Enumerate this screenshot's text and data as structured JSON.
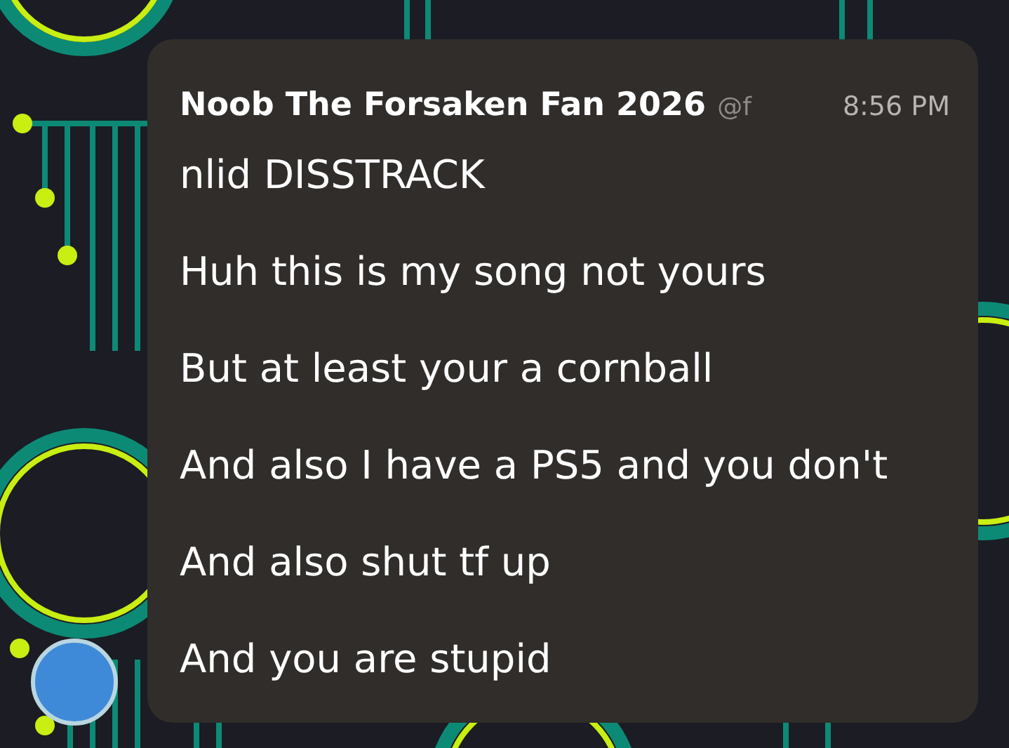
{
  "message": {
    "author": "Noob The Forsaken Fan 2026",
    "handle": "@f",
    "time": "8:56 PM",
    "lines": [
      "nlid DISSTRACK",
      "Huh this is my song not yours",
      "But at least your a cornball",
      "And also I have a PS5 and you don't",
      "And also shut tf up",
      "And you are stupid"
    ]
  }
}
